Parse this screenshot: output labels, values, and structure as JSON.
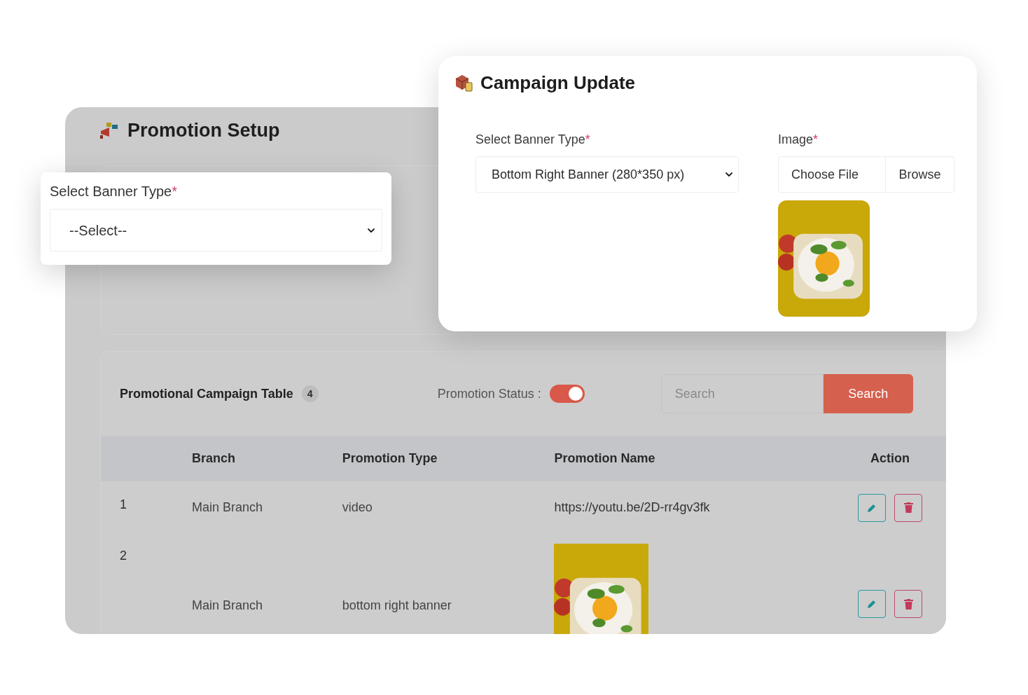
{
  "promotion_setup": {
    "title": "Promotion Setup"
  },
  "banner_card": {
    "label": "Select Banner Type",
    "required_mark": "*",
    "select": {
      "value": "--Select--"
    }
  },
  "campaign_update": {
    "title": "Campaign Update",
    "banner_type": {
      "label": "Select Banner Type",
      "required_mark": "*",
      "value": "Bottom Right Banner (280*350 px)"
    },
    "image": {
      "label": "Image",
      "required_mark": "*",
      "file_placeholder": "Choose File",
      "browse": "Browse"
    }
  },
  "table_card": {
    "title": "Promotional Campaign Table",
    "count": "4",
    "status_label": "Promotion Status :",
    "status_toggle": {
      "on": true
    },
    "search": {
      "placeholder": "Search",
      "button": "Search"
    },
    "columns": [
      "Branch",
      "Promotion Type",
      "Promotion Name",
      "Action"
    ],
    "rows": [
      {
        "index": "1",
        "branch": "Main Branch",
        "type": "video",
        "name": {
          "kind": "text",
          "text": "https://youtu.be/2D-rr4gv3fk"
        }
      },
      {
        "index": "2",
        "branch": "Main Branch",
        "type": "bottom right banner"
      }
    ]
  }
}
